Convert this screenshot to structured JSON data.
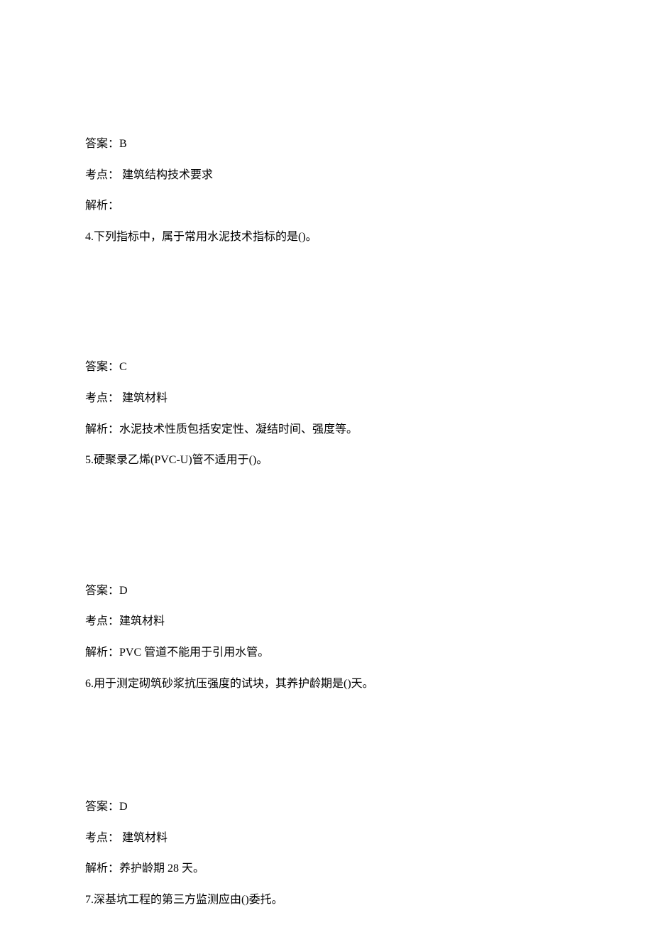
{
  "q3": {
    "answer_label": "答案：",
    "answer_value": "B",
    "point_label": "考点：",
    "point_value": " 建筑结构技术要求",
    "analysis_label": "解析："
  },
  "q4": {
    "question": "4.下列指标中，属于常用水泥技术指标的是()。",
    "answer_label": "答案：",
    "answer_value": "C",
    "point_label": "考点：",
    "point_value": " 建筑材料",
    "analysis_label": "解析：",
    "analysis_value": "水泥技术性质包括安定性、凝结时间、强度等。"
  },
  "q5": {
    "question": "5.硬聚录乙烯(PVC-U)管不适用于()。",
    "answer_label": "答案：",
    "answer_value": "D",
    "point_label": "考点：",
    "point_value": "建筑材料",
    "analysis_label": "解析：",
    "analysis_value": "PVC 管道不能用于引用水管。"
  },
  "q6": {
    "question": "6.用于测定砌筑砂浆抗压强度的试块，其养护龄期是()天。",
    "answer_label": "答案：",
    "answer_value": "D",
    "point_label": "考点：",
    "point_value": " 建筑材料",
    "analysis_label": "解析：",
    "analysis_value": "养护龄期 28 天。"
  },
  "q7": {
    "question": "7.深基坑工程的第三方监测应由()委托。"
  }
}
